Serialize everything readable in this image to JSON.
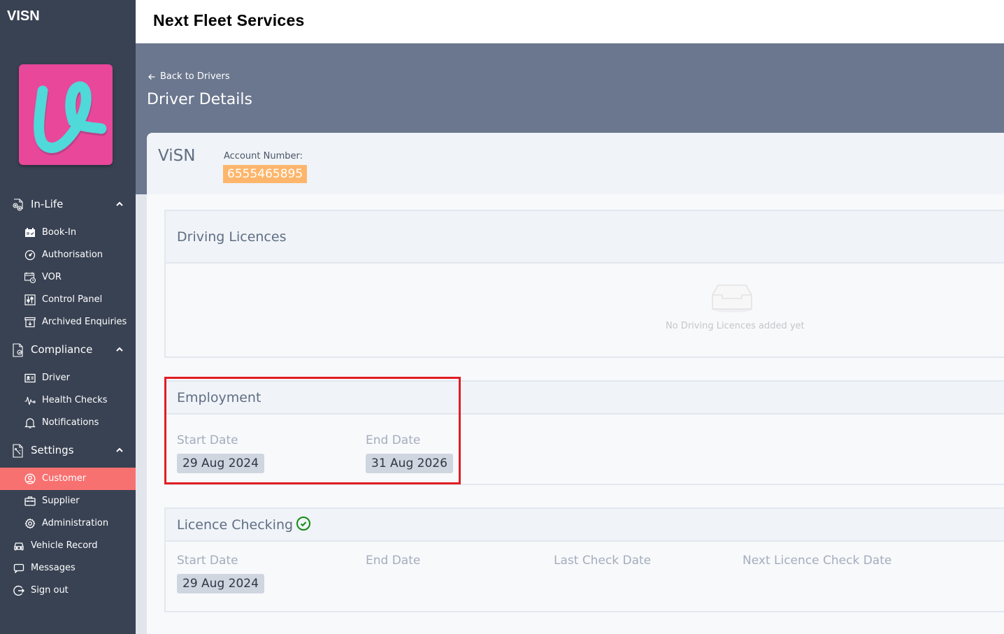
{
  "app": {
    "brand": "VISN",
    "logo_icon": "visn-logo-v",
    "colors": {
      "sidebar_bg": "#394253",
      "active_item": "#f87171",
      "banner_bg": "#6b778e",
      "account_badge": "#fdb66c",
      "logo_bg": "#e8479a",
      "logo_fg": "#4fd9d9",
      "highlight": "#e11d24",
      "check_green": "#138a13"
    }
  },
  "sidebar": {
    "groups": [
      {
        "label": "In-Life",
        "icon": "gears-document-icon",
        "expanded": true,
        "items": [
          {
            "label": "Book-In",
            "icon": "calendar-check-icon"
          },
          {
            "label": "Authorisation",
            "icon": "gauge-icon"
          },
          {
            "label": "VOR",
            "icon": "calendar-clock-icon"
          },
          {
            "label": "Control Panel",
            "icon": "sliders-icon"
          },
          {
            "label": "Archived Enquiries",
            "icon": "archive-icon"
          }
        ]
      },
      {
        "label": "Compliance",
        "icon": "document-shield-icon",
        "expanded": true,
        "items": [
          {
            "label": "Driver",
            "icon": "id-card-icon"
          },
          {
            "label": "Health Checks",
            "icon": "pulse-icon"
          },
          {
            "label": "Notifications",
            "icon": "bell-icon"
          }
        ]
      },
      {
        "label": "Settings",
        "icon": "document-tools-icon",
        "expanded": true,
        "items": [
          {
            "label": "Customer",
            "icon": "user-circle-icon",
            "active": true
          },
          {
            "label": "Supplier",
            "icon": "briefcase-icon"
          },
          {
            "label": "Administration",
            "icon": "gear-icon"
          }
        ]
      }
    ],
    "top_items": [
      {
        "label": "Vehicle Record",
        "icon": "car-icon"
      },
      {
        "label": "Messages",
        "icon": "message-icon"
      },
      {
        "label": "Sign out",
        "icon": "sign-out-icon"
      }
    ]
  },
  "header": {
    "org_title": "Next Fleet Services"
  },
  "banner": {
    "back_link": "Back to Drivers",
    "page_title": "Driver Details"
  },
  "customer": {
    "name": "ViSN",
    "account_label": "Account Number:",
    "account_number": "6555465895"
  },
  "sections": {
    "driving_licences": {
      "title": "Driving Licences",
      "empty_text": "No Driving Licences added yet",
      "empty_icon": "inbox-icon"
    },
    "employment": {
      "title": "Employment",
      "fields": [
        {
          "label": "Start Date",
          "value": "29 Aug 2024"
        },
        {
          "label": "End Date",
          "value": "31 Aug 2026"
        }
      ]
    },
    "licence_checking": {
      "title": "Licence Checking",
      "status_icon": "check-circle-icon",
      "fields": [
        {
          "label": "Start Date",
          "value": "29 Aug 2024"
        },
        {
          "label": "End Date",
          "value": null
        },
        {
          "label": "Last Check Date",
          "value": null
        },
        {
          "label": "Next Licence Check Date",
          "value": null
        }
      ]
    }
  }
}
